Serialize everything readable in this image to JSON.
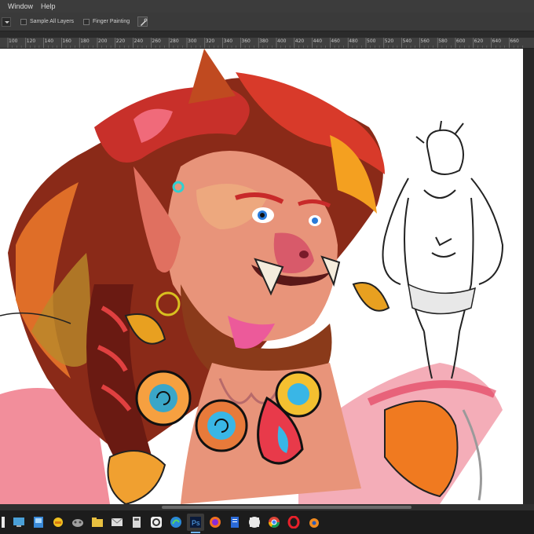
{
  "menubar": {
    "items": [
      "Window",
      "Help"
    ]
  },
  "options": {
    "sample_all_layers": "Sample All Layers",
    "finger_painting": "Finger Painting"
  },
  "ruler": {
    "ticks": [
      "100",
      "120",
      "140",
      "160",
      "180",
      "200",
      "220",
      "240",
      "260",
      "280",
      "300",
      "320",
      "340",
      "360",
      "380",
      "400",
      "420",
      "440",
      "460",
      "480",
      "500",
      "520",
      "540",
      "560",
      "580",
      "600",
      "620",
      "640",
      "660"
    ]
  },
  "taskbar": {
    "icons": [
      "desktop-icon",
      "task-view-icon",
      "files-app-icon",
      "game-icon",
      "maps-icon",
      "file-explorer-icon",
      "mail-icon",
      "calculator-icon",
      "chat-app-icon",
      "edge-browser-icon",
      "photoshop-icon",
      "firefox-icon",
      "notepad-icon",
      "chrome-icon",
      "opera-icon",
      "blender-icon"
    ]
  },
  "colors": {
    "ui_dark": "#3a3a3a",
    "canvas_bg": "#ffffff",
    "hair_red": "#c83a2a",
    "skin": "#e8947a",
    "accent_blue": "#39b6e6"
  }
}
